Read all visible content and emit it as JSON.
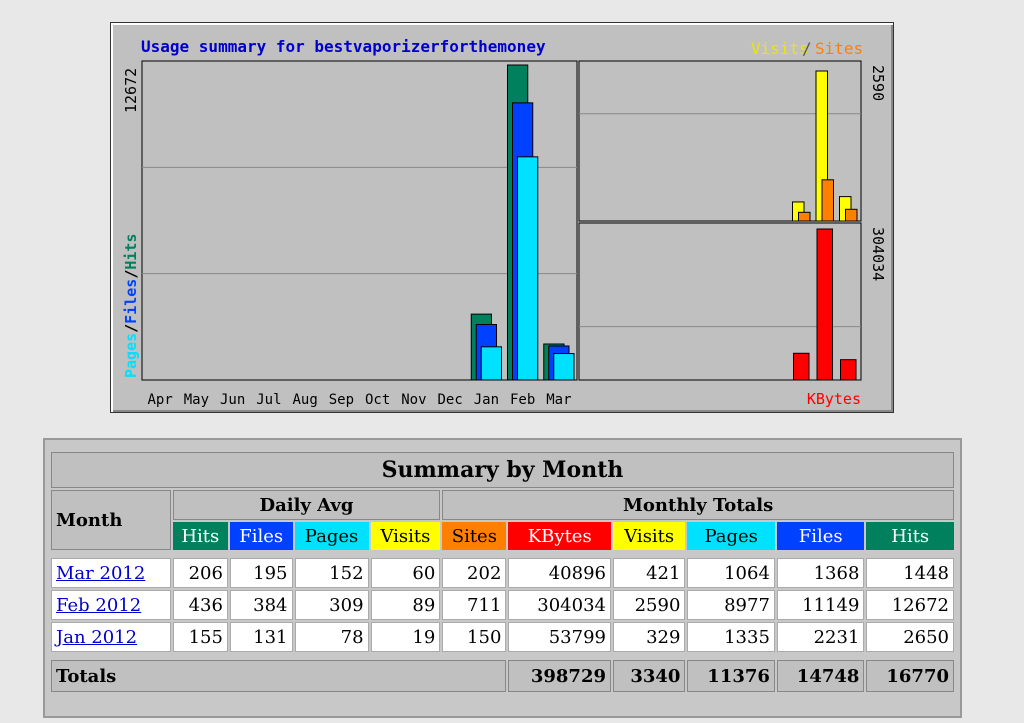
{
  "chart_data": {
    "type": "bar",
    "title": "Usage summary for bestvaporizerforthemoney",
    "legend_top_right": [
      "Visits",
      "Sites"
    ],
    "categories": [
      "Apr",
      "May",
      "Jun",
      "Jul",
      "Aug",
      "Sep",
      "Oct",
      "Nov",
      "Dec",
      "Jan",
      "Feb",
      "Mar"
    ],
    "left_panel": {
      "ylabel": [
        "Pages",
        "Files",
        "Hits"
      ],
      "ymax_label": "12672",
      "ylim": [
        0,
        12672
      ],
      "series": [
        {
          "name": "Hits",
          "values": [
            0,
            0,
            0,
            0,
            0,
            0,
            0,
            0,
            0,
            2650,
            12672,
            1448
          ]
        },
        {
          "name": "Files",
          "values": [
            0,
            0,
            0,
            0,
            0,
            0,
            0,
            0,
            0,
            2231,
            11149,
            1368
          ]
        },
        {
          "name": "Pages",
          "values": [
            0,
            0,
            0,
            0,
            0,
            0,
            0,
            0,
            0,
            1335,
            8977,
            1064
          ]
        }
      ]
    },
    "right_top_panel": {
      "ymax_label": "2590",
      "ylim": [
        0,
        2590
      ],
      "series": [
        {
          "name": "Visits",
          "values": [
            329,
            2590,
            421
          ]
        },
        {
          "name": "Sites",
          "values": [
            150,
            711,
            202
          ]
        }
      ],
      "categories": [
        "Jan",
        "Feb",
        "Mar"
      ]
    },
    "right_bottom_panel": {
      "ymax_label": "304034",
      "xlabel": "KBytes",
      "ylim": [
        0,
        304034
      ],
      "series": [
        {
          "name": "KBytes",
          "values": [
            53799,
            304034,
            40896
          ]
        }
      ],
      "categories": [
        "Jan",
        "Feb",
        "Mar"
      ]
    },
    "colors": {
      "hits": "#00805c",
      "files": "#0040ff",
      "pages": "#00e0ff",
      "visits": "#ffff00",
      "sites": "#ff8000",
      "kbytes": "#ff0000"
    }
  },
  "table": {
    "title": "Summary by Month",
    "month_header": "Month",
    "daily_avg_header": "Daily Avg",
    "monthly_totals_header": "Monthly Totals",
    "daily_cols": [
      "Hits",
      "Files",
      "Pages",
      "Visits"
    ],
    "monthly_cols": [
      "Sites",
      "KBytes",
      "Visits",
      "Pages",
      "Files",
      "Hits"
    ],
    "rows": [
      {
        "month": "Mar 2012",
        "daily": [
          "206",
          "195",
          "152",
          "60"
        ],
        "monthly": [
          "202",
          "40896",
          "421",
          "1064",
          "1368",
          "1448"
        ]
      },
      {
        "month": "Feb 2012",
        "daily": [
          "436",
          "384",
          "309",
          "89"
        ],
        "monthly": [
          "711",
          "304034",
          "2590",
          "8977",
          "11149",
          "12672"
        ]
      },
      {
        "month": "Jan 2012",
        "daily": [
          "155",
          "131",
          "78",
          "19"
        ],
        "monthly": [
          "150",
          "53799",
          "329",
          "1335",
          "2231",
          "2650"
        ]
      }
    ],
    "totals_label": "Totals",
    "totals": [
      "398729",
      "3340",
      "11376",
      "14748",
      "16770"
    ]
  }
}
